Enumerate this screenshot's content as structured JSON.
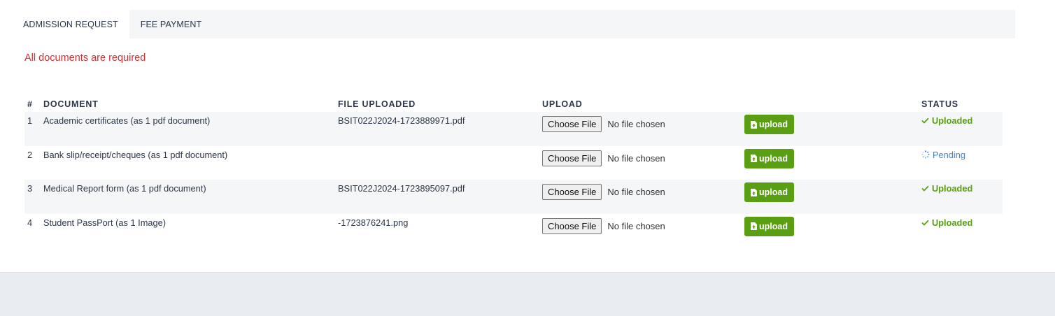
{
  "tabs": [
    {
      "label": "ADMISSION REQUEST",
      "active": true
    },
    {
      "label": "FEE PAYMENT",
      "active": false
    }
  ],
  "alert": "All documents are required",
  "table": {
    "headers": {
      "num": "#",
      "document": "DOCUMENT",
      "file": "FILE UPLOADED",
      "upload": "UPLOAD",
      "status": "STATUS"
    },
    "rows": [
      {
        "num": "1",
        "document": "Academic certificates (as 1 pdf document)",
        "file": "BSIT022J2024-1723889971.pdf",
        "choose": "Choose File",
        "chosen": "No file chosen",
        "upload": "upload",
        "status": "Uploaded"
      },
      {
        "num": "2",
        "document": "Bank slip/receipt/cheques (as 1 pdf document)",
        "file": "",
        "choose": "Choose File",
        "chosen": "No file chosen",
        "upload": "upload",
        "status": "Pending"
      },
      {
        "num": "3",
        "document": "Medical Report form (as 1 pdf document)",
        "file": "BSIT022J2024-1723895097.pdf",
        "choose": "Choose File",
        "chosen": "No file chosen",
        "upload": "upload",
        "status": "Uploaded"
      },
      {
        "num": "4",
        "document": "Student PassPort (as 1 Image)",
        "file": "-1723876241.png",
        "choose": "Choose File",
        "chosen": "No file chosen",
        "upload": "upload",
        "status": "Uploaded"
      }
    ]
  },
  "icons": {
    "upload": "file-upload-icon",
    "uploaded": "check-icon",
    "pending": "spinner-icon"
  },
  "colors": {
    "accent_green": "#5a9e14",
    "alert_red": "#d32f2f",
    "pending_blue": "#4a86c8"
  }
}
